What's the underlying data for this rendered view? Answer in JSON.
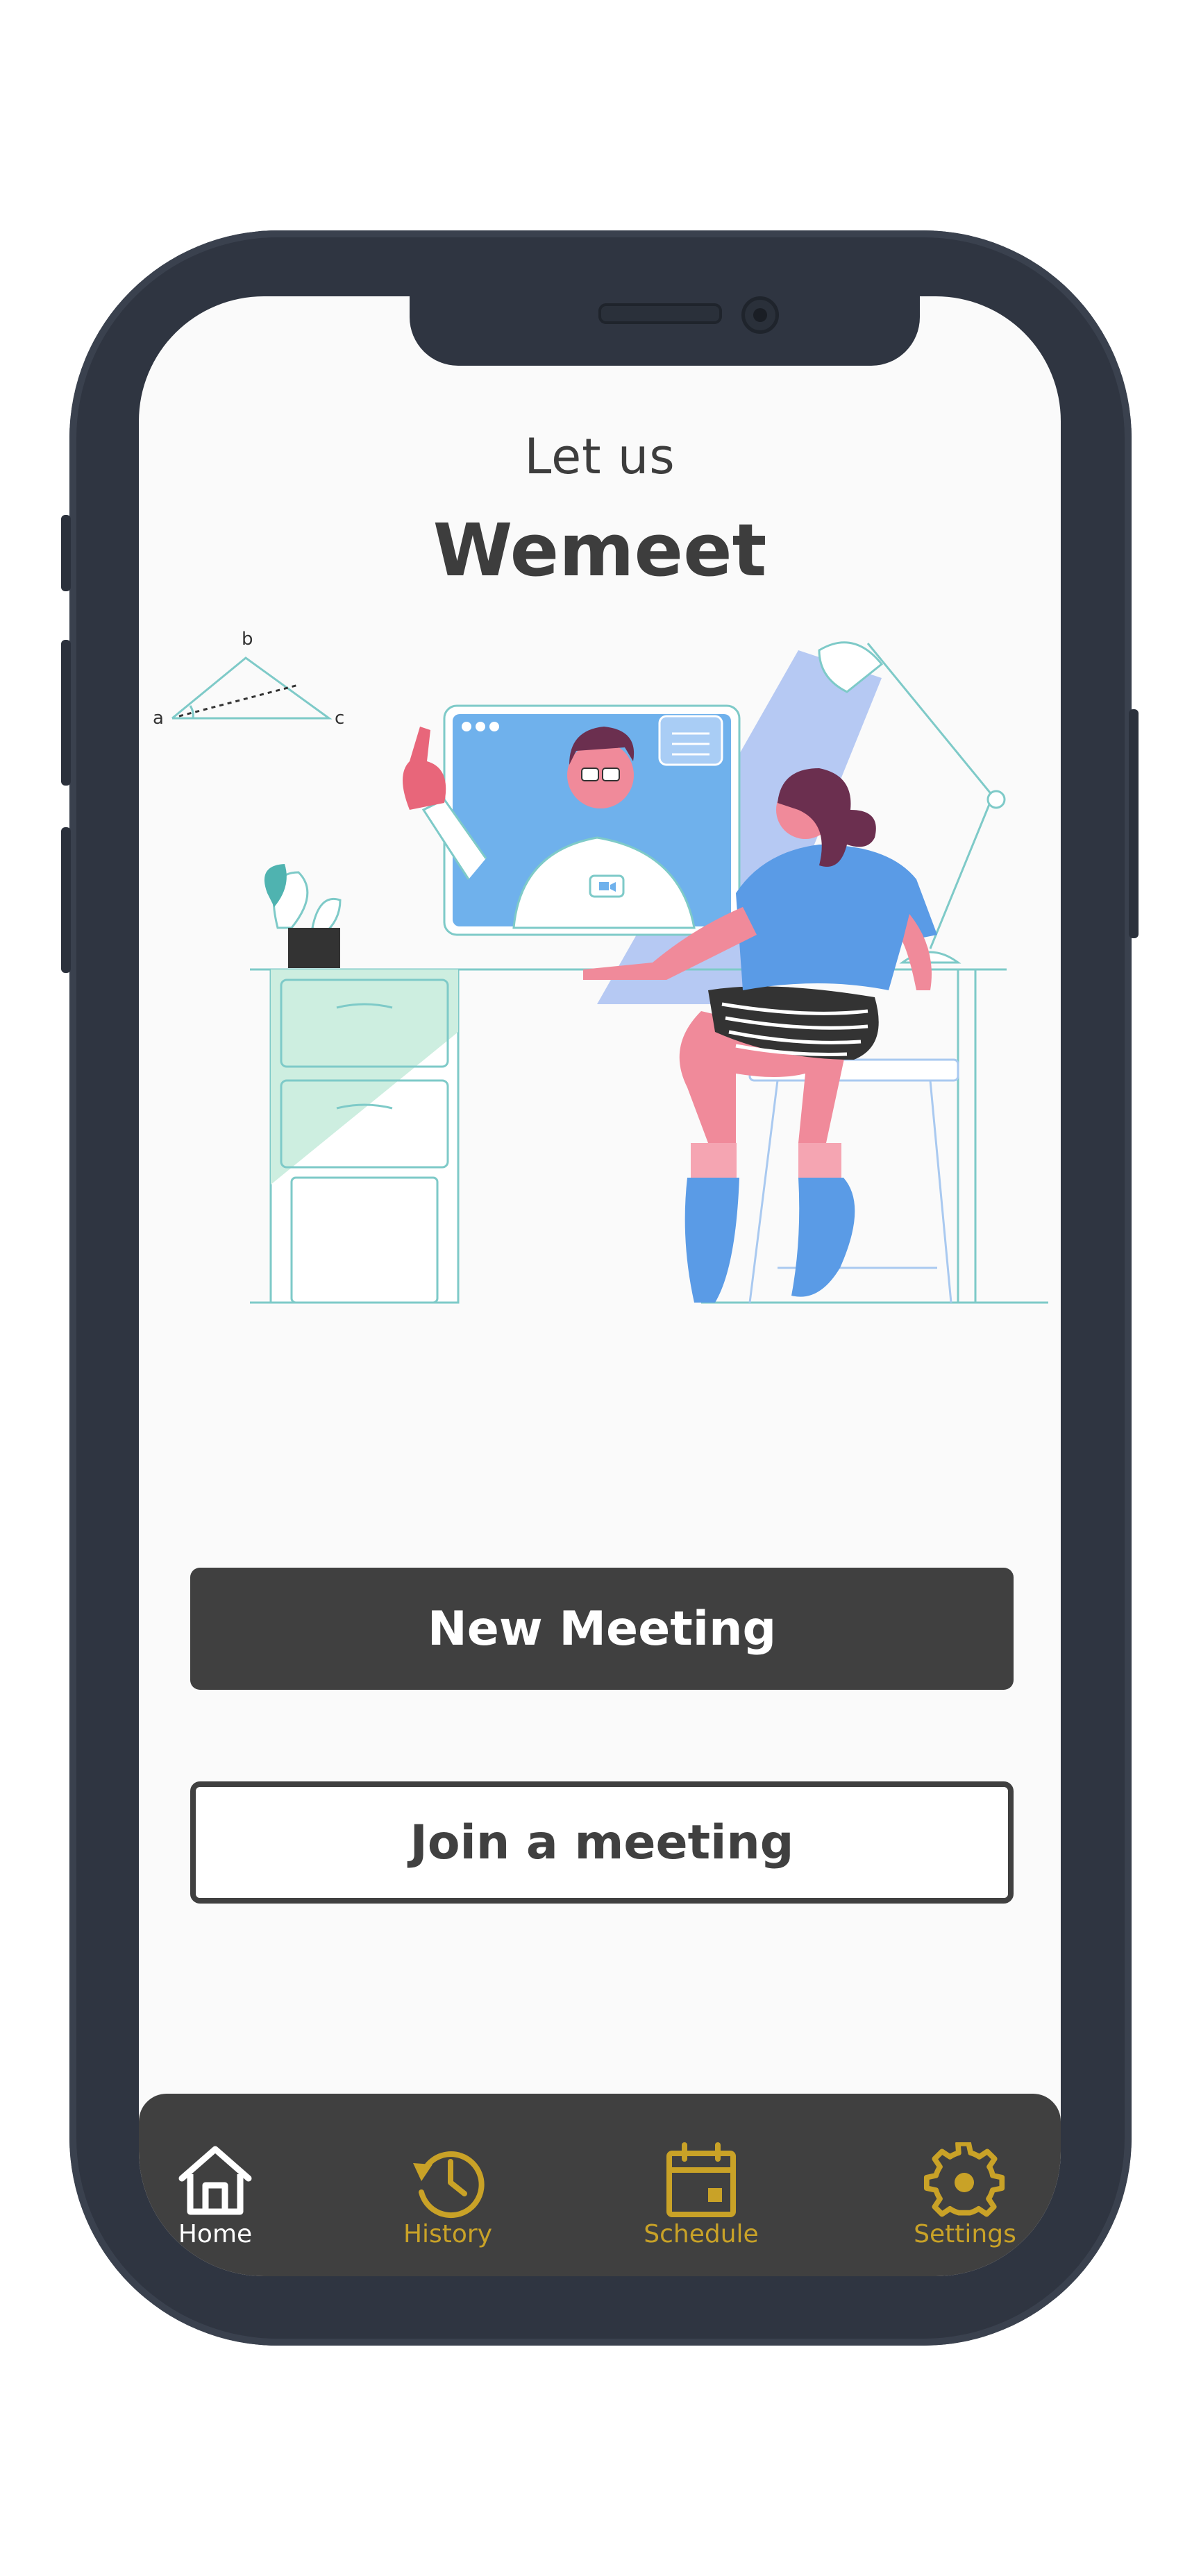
{
  "header": {
    "subtitle": "Let us",
    "title": "Wemeet"
  },
  "actions": {
    "new_meeting_label": "New Meeting",
    "join_meeting_label": "Join a meeting"
  },
  "tabbar": {
    "items": [
      {
        "label": "Home",
        "icon": "home-icon",
        "active": true
      },
      {
        "label": "History",
        "icon": "history-icon",
        "active": false
      },
      {
        "label": "Schedule",
        "icon": "calendar-icon",
        "active": false
      },
      {
        "label": "Settings",
        "icon": "gear-icon",
        "active": false
      }
    ]
  },
  "illustration": {
    "labels": [
      "b",
      "a",
      "c"
    ]
  },
  "colors": {
    "primary": "#404040",
    "accent": "#c9a227",
    "background": "#fafafa",
    "phone_frame": "#2f3541"
  }
}
